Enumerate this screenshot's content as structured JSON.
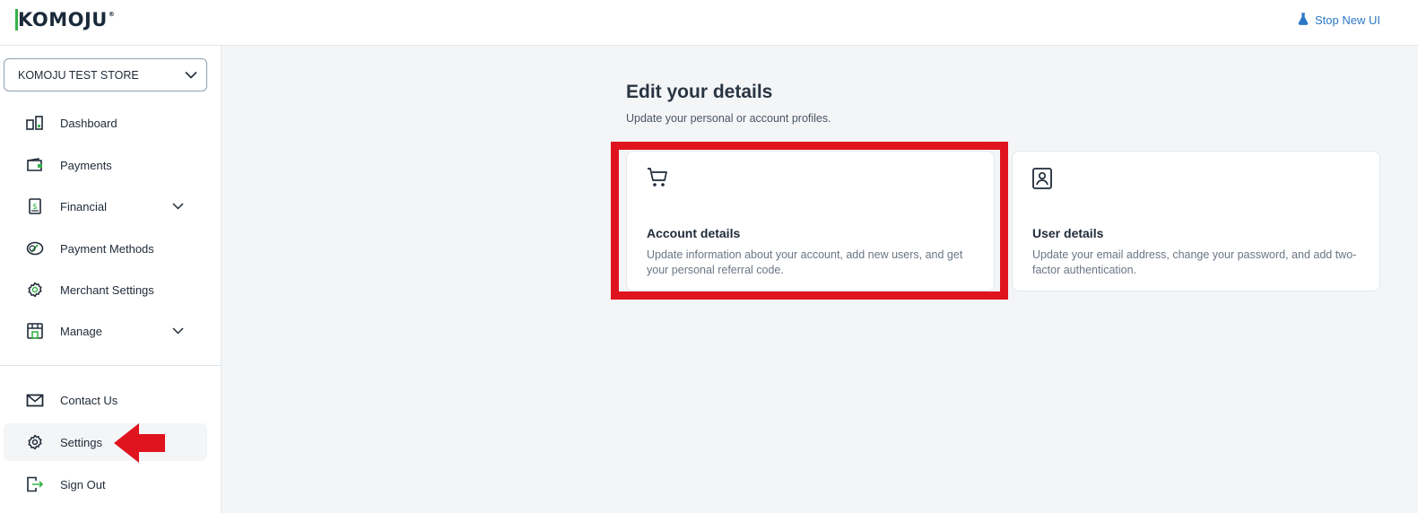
{
  "brand": {
    "logo_text": "KOMOJU",
    "accent_color": "#35b24a",
    "primary_color": "#1b2a3a"
  },
  "header": {
    "stop_new_ui_label": "Stop New UI",
    "stop_new_ui_icon": "flask-icon",
    "link_color": "#2c78c7"
  },
  "sidebar": {
    "store_selector": {
      "value": "KOMOJU TEST STORE",
      "icon": "chevron-down-icon"
    },
    "items": [
      {
        "label": "Dashboard",
        "icon": "dashboard-icon"
      },
      {
        "label": "Payments",
        "icon": "wallet-icon"
      },
      {
        "label": "Financial",
        "icon": "ledger-icon",
        "expandable": true
      },
      {
        "label": "Payment Methods",
        "icon": "payment-methods-icon"
      },
      {
        "label": "Merchant Settings",
        "icon": "gear-icon"
      },
      {
        "label": "Manage",
        "icon": "store-icon",
        "expandable": true
      }
    ],
    "bottom_items": [
      {
        "label": "Contact Us",
        "icon": "mail-icon"
      },
      {
        "label": "Settings",
        "icon": "gear-icon",
        "active": true
      },
      {
        "label": "Sign Out",
        "icon": "sign-out-icon"
      }
    ]
  },
  "main": {
    "title": "Edit your details",
    "subtitle": "Update your personal or account profiles.",
    "cards": [
      {
        "title": "Account details",
        "description": "Update information about your account, add new users, and get your personal referral code.",
        "icon": "cart-icon",
        "highlighted": true
      },
      {
        "title": "User details",
        "description": "Update your email address, change your password, and add two-factor authentication.",
        "icon": "user-badge-icon"
      }
    ]
  },
  "annotations": {
    "highlight_color": "#e0141e"
  }
}
